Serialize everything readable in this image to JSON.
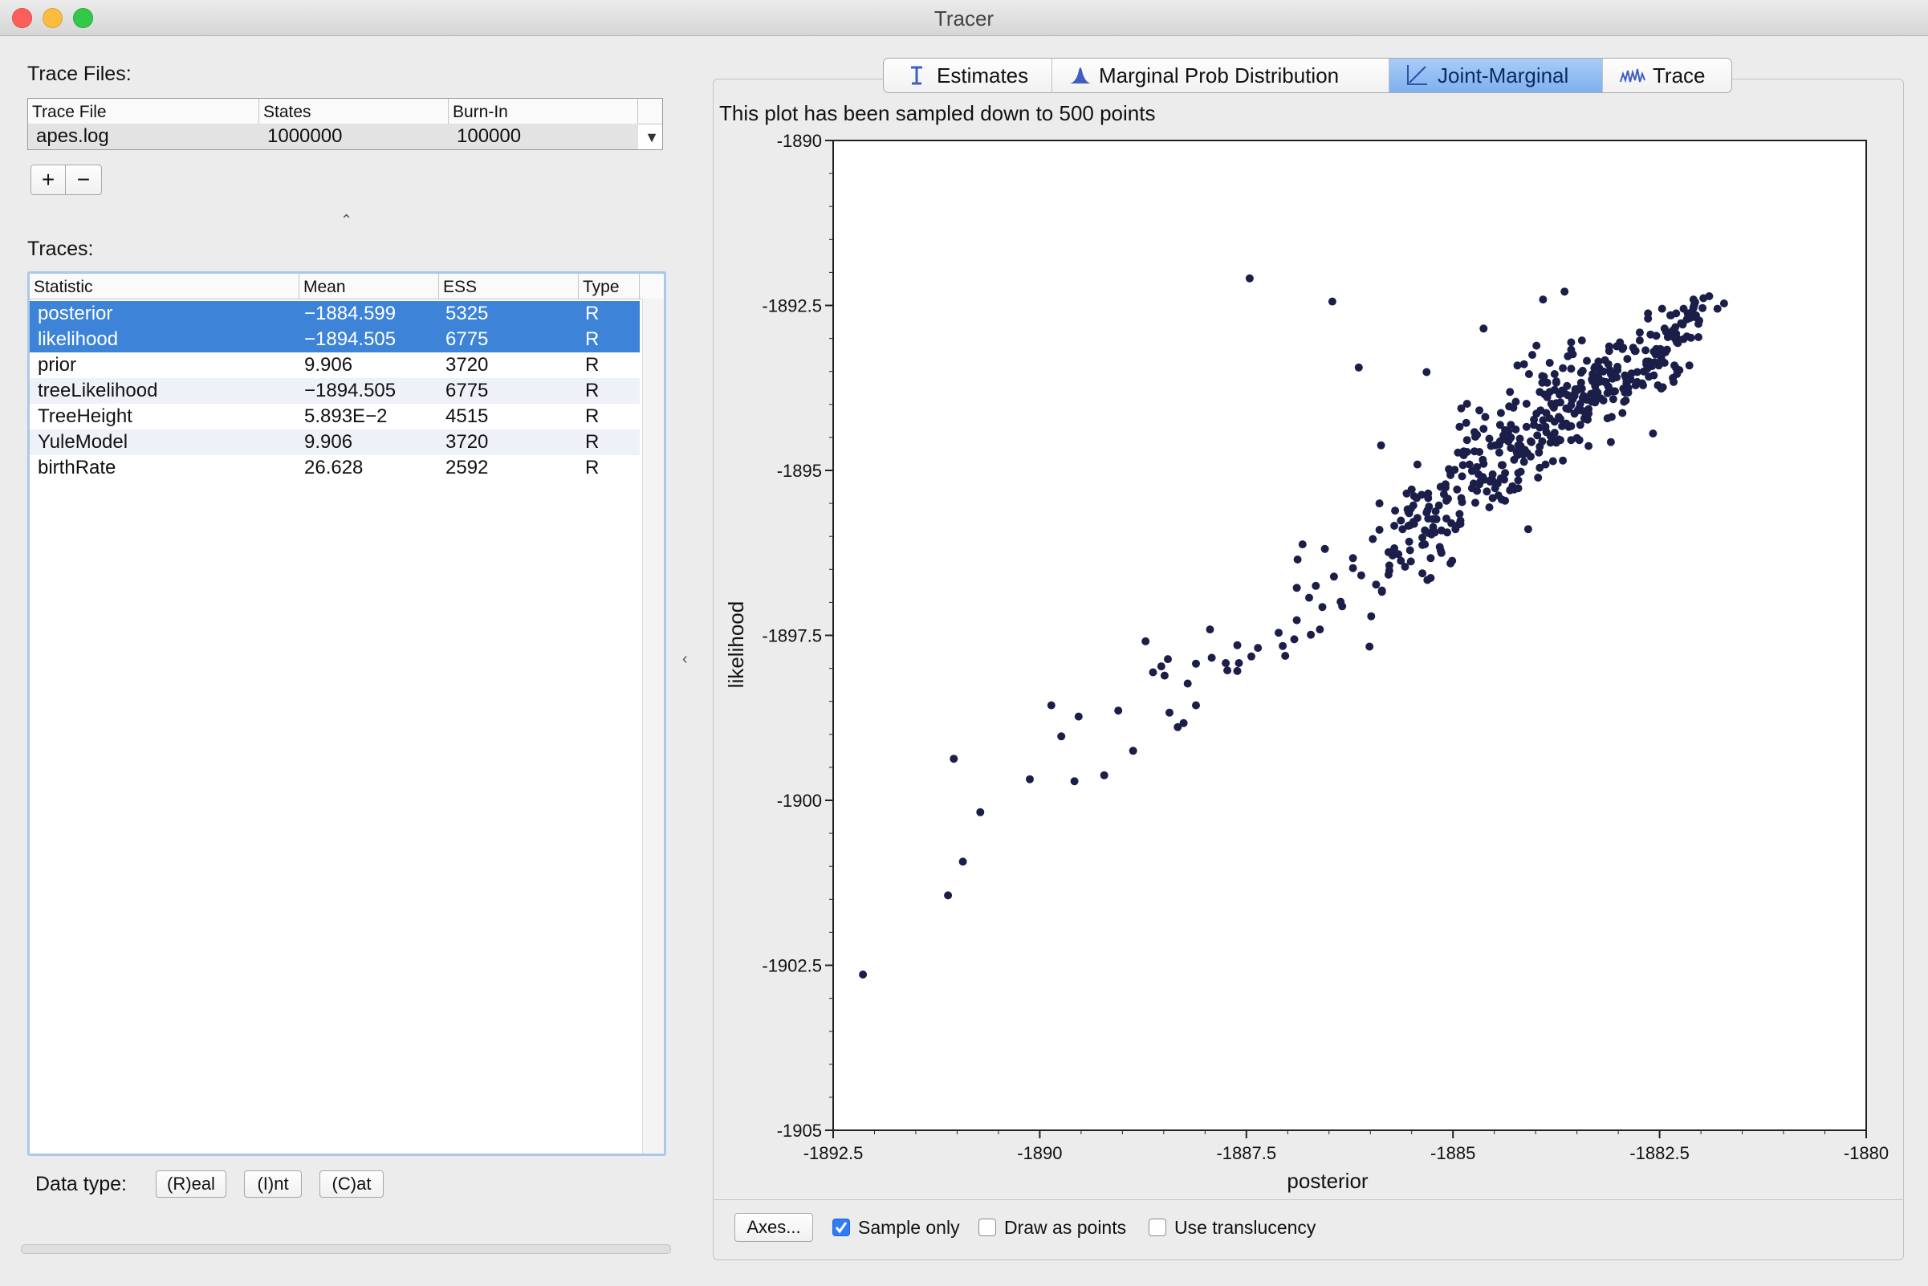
{
  "window": {
    "title": "Tracer"
  },
  "trace_files": {
    "label": "Trace Files:",
    "columns": [
      "Trace File",
      "States",
      "Burn-In"
    ],
    "rows": [
      {
        "file": "apes.log",
        "states": "1000000",
        "burnin": "100000"
      }
    ],
    "add_label": "+",
    "remove_label": "−"
  },
  "traces": {
    "label": "Traces:",
    "columns": [
      "Statistic",
      "Mean",
      "ESS",
      "Type"
    ],
    "rows": [
      {
        "statistic": "posterior",
        "mean": "−1884.599",
        "ess": "5325",
        "type": "R",
        "selected": true
      },
      {
        "statistic": "likelihood",
        "mean": "−1894.505",
        "ess": "6775",
        "type": "R",
        "selected": true
      },
      {
        "statistic": "prior",
        "mean": "9.906",
        "ess": "3720",
        "type": "R",
        "selected": false
      },
      {
        "statistic": "treeLikelihood",
        "mean": "−1894.505",
        "ess": "6775",
        "type": "R",
        "selected": false
      },
      {
        "statistic": "TreeHeight",
        "mean": "5.893E−2",
        "ess": "4515",
        "type": "R",
        "selected": false
      },
      {
        "statistic": "YuleModel",
        "mean": "9.906",
        "ess": "3720",
        "type": "R",
        "selected": false
      },
      {
        "statistic": "birthRate",
        "mean": "26.628",
        "ess": "2592",
        "type": "R",
        "selected": false
      }
    ]
  },
  "data_type": {
    "label": "Data type:",
    "real_label": "(R)eal",
    "int_label": "(I)nt",
    "cat_label": "(C)at"
  },
  "tabs": [
    {
      "label": "Estimates",
      "icon": "estimates-icon",
      "active": false
    },
    {
      "label": "Marginal Prob Distribution",
      "icon": "distribution-icon",
      "active": false
    },
    {
      "label": "Joint-Marginal",
      "icon": "joint-marginal-icon",
      "active": true
    },
    {
      "label": "Trace",
      "icon": "trace-icon",
      "active": false
    }
  ],
  "plot": {
    "note": "This plot has been sampled down to 500 points"
  },
  "bottom_bar": {
    "axes_label": "Axes...",
    "sample_only": {
      "label": "Sample only",
      "checked": true
    },
    "draw_points": {
      "label": "Draw as points",
      "checked": false
    },
    "translucency": {
      "label": "Use translucency",
      "checked": false
    }
  },
  "colors": {
    "accent": "#3d83d7",
    "points": "#1c1e4a"
  },
  "chart_data": {
    "type": "scatter",
    "xlabel": "posterior",
    "ylabel": "likelihood",
    "xlim": [
      -1892.5,
      -1880
    ],
    "ylim": [
      -1905,
      -1890
    ],
    "xticks": [
      -1892.5,
      -1890,
      -1887.5,
      -1885,
      -1882.5,
      -1880
    ],
    "xtick_labels": [
      "-1892.5",
      "-1890",
      "-1887.5",
      "-1885",
      "-1882.5",
      "-1880"
    ],
    "yticks": [
      -1890,
      -1892.5,
      -1895,
      -1897.5,
      -1900,
      -1902.5,
      -1905
    ],
    "ytick_labels": [
      "-1890",
      "-1892.5",
      "-1895",
      "-1897.5",
      "-1900",
      "-1902.5",
      "-1905"
    ],
    "grid": false,
    "x": [
      -1892.14,
      -1891.11,
      -1890.93,
      -1891.04,
      -1890.72,
      -1890.12,
      -1889.86,
      -1889.58,
      -1889.74,
      -1889.22,
      -1889.53,
      -1889.05,
      -1888.87,
      -1888.63,
      -1888.72,
      -1888.43,
      -1888.53,
      -1888.45,
      -1888.33,
      -1888.11,
      -1888.49,
      -1888.26,
      -1888.11,
      -1888.21,
      -1887.92,
      -1887.73,
      -1887.94,
      -1887.75,
      -1887.61,
      -1887.44,
      -1887.36,
      -1887.61,
      -1887.59,
      -1887.11,
      -1887.03,
      -1887.06,
      -1886.89,
      -1886.92,
      -1886.72,
      -1886.61,
      -1886.74,
      -1886.58,
      -1886.44,
      -1886.36,
      -1886.21,
      -1885.93,
      -1885.71,
      -1885.58,
      -1885.43,
      -1885.29,
      -1885.08,
      -1884.93,
      -1884.71,
      -1884.55,
      -1884.37,
      -1884.21,
      -1884.06,
      -1883.88,
      -1883.72,
      -1883.53,
      -1883.36,
      -1883.18,
      -1883.01,
      -1882.84,
      -1882.67,
      -1882.51,
      -1882.33,
      -1882.17,
      -1882.03,
      -1881.9,
      -1881.8,
      -1881.72,
      -1884.63,
      -1883.91,
      -1883.65,
      -1885.32,
      -1883.44,
      -1886.46,
      -1887.46,
      -1885.87,
      -1886.14,
      -1884.87,
      -1883.02,
      -1884.45,
      -1882.74,
      -1883.27,
      -1885.99,
      -1884.09,
      -1882.4,
      -1883.79,
      -1884.22,
      -1885.14,
      -1882.95,
      -1886.11,
      -1883.57,
      -1884.38,
      -1883.09,
      -1884.68,
      -1882.12,
      -1886.34,
      -1885.55,
      -1882.58,
      -1884.83,
      -1883.75,
      -1885.44,
      -1883.33,
      -1882.89,
      -1885.78,
      -1885.34,
      -1884.49,
      -1882.24,
      -1884.27,
      -1886.01,
      -1883.61,
      -1882.47,
      -1885.2,
      -1886.55,
      -1884.31,
      -1882.79,
      -1885.61,
      -1883.99,
      -1882.37,
      -1886.66,
      -1884.18,
      -1883.41,
      -1885.03,
      -1885.86,
      -1882.63,
      -1882.94,
      -1884.8,
      -1886.21,
      -1883.13,
      -1883.7,
      -1885.71,
      -1886.88,
      -1883.47,
      -1882.21,
      -1882.55,
      -1882.02,
      -1885.97,
      -1883.62,
      -1884.95,
      -1885.24,
      -1881.98,
      -1882.77,
      -1884.74,
      -1883.36,
      -1883.6,
      -1883.95,
      -1886.82,
      -1885.53,
      -1883.45,
      -1882.3,
      -1883.7,
      -1882.79,
      -1882.44,
      -1881.97,
      -1882.91,
      -1882.49,
      -1884.24,
      -1884.04,
      -1885.15,
      -1882.65,
      -1883.78,
      -1883.95,
      -1884.14,
      -1885.02,
      -1882.69,
      -1884.71,
      -1884.3,
      -1884.98,
      -1884.77,
      -1883.29,
      -1886.89,
      -1884.14,
      -1883.44,
      -1884.3,
      -1884.63,
      -1884.21,
      -1882.61,
      -1883.12,
      -1884.91,
      -1883.43,
      -1882.66,
      -1884.02,
      -1883.83,
      -1883.46,
      -1883.75,
      -1883.71,
      -1883.12,
      -1883.23,
      -1884.43,
      -1882.29,
      -1884.37,
      -1882.28,
      -1884.22,
      -1885.11,
      -1884.68,
      -1885.47,
      -1885.89,
      -1884.49,
      -1883.09,
      -1882.51,
      -1883.89,
      -1884.24,
      -1882.94,
      -1883.56,
      -1883.27,
      -1885.7,
      -1884.94,
      -1883.15,
      -1882.6,
      -1885.29,
      -1884.31,
      -1883.87,
      -1885.07,
      -1885.27,
      -1884.42,
      -1883.25,
      -1882.95,
      -1884.21,
      -1885.17,
      -1882.56,
      -1883.5,
      -1885.03,
      -1882.43,
      -1885.48,
      -1882.54,
      -1882.31,
      -1882.63,
      -1884.26,
      -1883.49,
      -1883.63,
      -1883.57,
      -1882.36,
      -1882.12,
      -1883.23,
      -1883.22,
      -1882.17,
      -1882.13,
      -1884.52,
      -1883.48,
      -1884.87,
      -1883.77,
      -1885.06,
      -1883.92,
      -1882.52,
      -1884.77,
      -1884.33,
      -1883.02,
      -1883.88,
      -1884.39,
      -1883.16,
      -1883.4,
      -1885.38,
      -1883.75,
      -1882.28,
      -1882.3,
      -1883.68,
      -1885.24,
      -1882.21,
      -1883.65,
      -1884.05,
      -1883.95,
      -1882.92,
      -1885.66,
      -1884.18,
      -1884.71,
      -1884.67,
      -1885.47,
      -1882.71,
      -1884.53,
      -1882.57,
      -1883.12,
      -1884.02,
      -1883.07,
      -1884.97,
      -1883.24,
      -1884.43,
      -1884.73,
      -1885.14,
      -1882.66,
      -1883.01,
      -1883.53,
      -1884.91,
      -1885.53,
      -1883.1,
      -1882.07,
      -1883.86,
      -1884.83,
      -1885.15,
      -1884.33,
      -1883.38,
      -1884.51,
      -1885.86,
      -1882.09,
      -1884.11,
      -1883.27,
      -1883.57,
      -1884.19,
      -1884.46,
      -1884.89,
      -1883.75,
      -1882.12,
      -1882.9,
      -1885.5,
      -1883.08,
      -1883.9,
      -1885.37,
      -1884.29,
      -1882.03,
      -1882.82,
      -1885.34,
      -1884.3,
      -1882.88,
      -1884.44,
      -1883.95,
      -1885.51,
      -1882.16,
      -1883.32,
      -1882.91,
      -1885.27,
      -1882.3,
      -1882.54,
      -1884.42,
      -1884.63,
      -1883.67,
      -1883.21,
      -1882.59,
      -1883.28,
      -1882.32,
      -1883.31,
      -1882.48,
      -1883.81,
      -1884.22,
      -1883.53,
      -1884.69,
      -1882.64,
      -1884.32,
      -1883.77,
      -1883.29,
      -1882.09,
      -1883.43,
      -1882.44,
      -1885.3,
      -1884.41,
      -1882.55,
      -1884.61,
      -1885.05,
      -1884.37,
      -1883.11,
      -1883.42,
      -1882.08,
      -1882.98,
      -1883.77,
      -1882.26,
      -1884.26,
      -1883.97,
      -1882.8,
      -1882.14,
      -1883.92,
      -1885.31,
      -1884.08,
      -1883.79,
      -1883.82,
      -1883.94,
      -1885.08,
      -1882.34,
      -1885.3,
      -1882.7,
      -1885.32,
      -1885.01,
      -1885.26,
      -1884.06,
      -1884.1,
      -1884.75,
      -1883.57,
      -1882.9,
      -1882.33,
      -1882.3,
      -1885.78,
      -1883.91,
      -1882.33,
      -1884.59,
      -1885.56,
      -1883.8,
      -1885.63,
      -1883.18,
      -1882.06,
      -1884.92,
      -1883.98,
      -1882.46,
      -1884.54,
      -1883.07,
      -1882.77,
      -1884.83,
      -1884.31,
      -1885.24,
      -1885.37,
      -1883.06,
      -1883.7,
      -1884.44,
      -1883.57,
      -1882.33,
      -1883.96,
      -1885.51,
      -1884.15,
      -1884.64,
      -1883.31,
      -1884.73,
      -1883.49,
      -1885.03,
      -1885.77,
      -1885.21,
      -1883.32,
      -1883.11,
      -1883.04,
      -1883.67,
      -1883.28,
      -1884.62,
      -1882.9,
      -1882.85,
      -1883.99,
      -1883.57,
      -1884.21,
      -1885.48,
      -1883.68,
      -1885.31,
      -1883.47,
      -1885.16,
      -1883.6,
      -1883.83,
      -1883.43,
      -1882.29,
      -1884.56,
      -1885.73,
      -1885.22,
      -1884.28,
      -1882.09,
      -1884.39,
      -1882.64,
      -1883.61,
      -1883.13,
      -1885.89,
      -1884.23,
      -1883.55,
      -1885.77,
      -1883.77,
      -1884.41,
      -1884.89,
      -1882.92,
      -1884.84,
      -1882.88,
      -1884.9,
      -1882.34,
      -1882.64,
      -1883.45,
      -1882.93,
      -1882.22,
      -1883.25,
      -1883.24,
      -1882.57,
      -1883.86,
      -1883.82,
      -1882.12,
      -1882.14,
      -1883.52,
      -1884.4,
      -1882.47,
      -1882.41,
      -1884.11,
      -1882.06,
      -1885.63,
      -1884.52,
      -1883.46,
      -1885.09,
      -1885.09,
      -1885.37,
      -1883.15,
      -1883.83,
      -1884.92,
      -1883.92,
      -1885.3,
      -1885.52,
      -1883.28,
      -1883.37,
      -1883.55,
      -1883.87,
      -1883.29,
      -1884.74,
      -1883.63,
      -1883.19,
      -1884.13,
      -1883.72,
      -1882.42,
      -1883.28,
      -1883.36,
      -1882.74,
      -1884.64,
      -1885.43,
      -1884.9,
      -1882.48,
      -1884.68,
      -1884.56,
      -1883.07,
      -1883.38,
      -1884.88,
      -1885.54,
      -1885.52,
      -1885.54
    ],
    "y": [
      -1902.64,
      -1901.44,
      -1900.93,
      -1899.37,
      -1900.18,
      -1899.68,
      -1898.56,
      -1899.71,
      -1899.03,
      -1899.62,
      -1898.73,
      -1898.64,
      -1899.25,
      -1898.06,
      -1897.59,
      -1898.67,
      -1897.97,
      -1897.86,
      -1898.89,
      -1898.56,
      -1898.11,
      -1898.83,
      -1897.93,
      -1898.23,
      -1897.84,
      -1898.03,
      -1897.41,
      -1897.92,
      -1898.04,
      -1897.82,
      -1897.69,
      -1897.65,
      -1897.92,
      -1897.46,
      -1897.81,
      -1897.66,
      -1897.27,
      -1897.56,
      -1897.49,
      -1897.41,
      -1896.93,
      -1897.07,
      -1896.61,
      -1896.99,
      -1896.33,
      -1896.73,
      -1896.18,
      -1896.46,
      -1895.72,
      -1895.95,
      -1895.46,
      -1895.82,
      -1895.31,
      -1895.17,
      -1895.04,
      -1895.15,
      -1894.79,
      -1894.34,
      -1894.53,
      -1894.14,
      -1894.07,
      -1893.94,
      -1893.48,
      -1893.53,
      -1893.18,
      -1893.41,
      -1892.98,
      -1892.71,
      -1892.78,
      -1892.36,
      -1892.55,
      -1892.47,
      -1892.85,
      -1892.41,
      -1892.29,
      -1893.51,
      -1893.03,
      -1892.44,
      -1892.09,
      -1894.62,
      -1893.44,
      -1894.77,
      -1893.12,
      -1895.38,
      -1892.91,
      -1893.59,
      -1897.21,
      -1895.89,
      -1892.98,
      -1894.86,
      -1893.41,
      -1895.91,
      -1894.13,
      -1896.59,
      -1893.06,
      -1895.14,
      -1894.57,
      -1894.09,
      -1892.61,
      -1897.06,
      -1895.59,
      -1894.44,
      -1893.99,
      -1893.65,
      -1895.42,
      -1893.84,
      -1893.31,
      -1896.24,
      -1896.12,
      -1894.62,
      -1892.77,
      -1894.05,
      -1897.67,
      -1893.27,
      -1892.55,
      -1895.74,
      -1896.19,
      -1894.52,
      -1893.71,
      -1895.89,
      -1893.11,
      -1892.65,
      -1896.75,
      -1895.02,
      -1894.21,
      -1896.41,
      -1896.82,
      -1893.35,
      -1893.76,
      -1894.91,
      -1896.48,
      -1894.21,
      -1893.97,
      -1895.84,
      -1896.35,
      -1894.05,
      -1893.01,
      -1893.38,
      -1892.73,
      -1896.04,
      -1893.72,
      -1895.29,
      -1895.93,
      -1892.54,
      -1893.51,
      -1894.42,
      -1894.14,
      -1894.34,
      -1893.81,
      -1896.12,
      -1895.65,
      -1893.52,
      -1893.03,
      -1894.54,
      -1893.19,
      -1892.85,
      -1892.39,
      -1893.94,
      -1893.16,
      -1893.96,
      -1893.25,
      -1896.21,
      -1893.46,
      -1894.05,
      -1894.96,
      -1894.87,
      -1895.8,
      -1893.5,
      -1894.95,
      -1894.31,
      -1894.99,
      -1895.27,
      -1893.45,
      -1896.78,
      -1893.39,
      -1893.76,
      -1894.66,
      -1894.37,
      -1895.27,
      -1892.94,
      -1893.73,
      -1895.76,
      -1894.1,
      -1893.35,
      -1894.23,
      -1893.81,
      -1893.99,
      -1894.58,
      -1893.85,
      -1893.73,
      -1893.45,
      -1894.31,
      -1893.06,
      -1894.39,
      -1893.01,
      -1894.77,
      -1895.36,
      -1894.72,
      -1895.81,
      -1895.5,
      -1895.27,
      -1893.54,
      -1893.19,
      -1893.85,
      -1894.38,
      -1893.14,
      -1893.93,
      -1893.79,
      -1895.61,
      -1894.73,
      -1893.66,
      -1893.37,
      -1895.55,
      -1895.3,
      -1894.13,
      -1895.94,
      -1896.63,
      -1895.12,
      -1893.82,
      -1893.16,
      -1894.62,
      -1895.53,
      -1893.36,
      -1894.51,
      -1895.03,
      -1893.21,
      -1895.53,
      -1893.16,
      -1892.83,
      -1893.58,
      -1895.29,
      -1893.78,
      -1894.06,
      -1894.33,
      -1892.65,
      -1892.68,
      -1893.66,
      -1893.5,
      -1892.97,
      -1892.69,
      -1895.06,
      -1893.76,
      -1894.71,
      -1893.54,
      -1895.43,
      -1893.57,
      -1893.71,
      -1895.01,
      -1894.41,
      -1893.59,
      -1894.91,
      -1894.53,
      -1893.33,
      -1894.22,
      -1895.37,
      -1893.67,
      -1893.07,
      -1893.45,
      -1894.33,
      -1895.86,
      -1892.55,
      -1893.83,
      -1894.57,
      -1894.35,
      -1893.56,
      -1896.27,
      -1894.63,
      -1894.46,
      -1895.17,
      -1895.39,
      -1893.68,
      -1895.13,
      -1893.2,
      -1893.39,
      -1894.31,
      -1893.61,
      -1895.89,
      -1893.35,
      -1894.56,
      -1895.49,
      -1896.25,
      -1893.39,
      -1893.43,
      -1893.87,
      -1895.81,
      -1896.08,
      -1893.48,
      -1892.45,
      -1893.89,
      -1894.54,
      -1895.25,
      -1894.56,
      -1893.93,
      -1895.17,
      -1896.84,
      -1892.54,
      -1893.99,
      -1893.85,
      -1893.46,
      -1894.52,
      -1895.2,
      -1895.48,
      -1893.98,
      -1892.99,
      -1893.68,
      -1895.29,
      -1894.19,
      -1893.58,
      -1896.56,
      -1895.28,
      -1892.98,
      -1893.14,
      -1895.91,
      -1894.5,
      -1893.82,
      -1894.61,
      -1894.64,
      -1896.38,
      -1892.62,
      -1893.62,
      -1893.59,
      -1896.33,
      -1892.93,
      -1892.96,
      -1894.13,
      -1894.9,
      -1894.85,
      -1893.91,
      -1893.42,
      -1893.58,
      -1893.41,
      -1893.65,
      -1893.3,
      -1893.99,
      -1894.72,
      -1893.84,
      -1895.06,
      -1893.44,
      -1894.03,
      -1894.26,
      -1893.61,
      -1892.41,
      -1893.9,
      -1893.37,
      -1895.73,
      -1894.92,
      -1893.24,
      -1894.19,
      -1894.98,
      -1895.46,
      -1893.19,
      -1893.87,
      -1892.49,
      -1893.06,
      -1894.43,
      -1893.48,
      -1894.84,
      -1895.11,
      -1893.19,
      -1893.41,
      -1893.67,
      -1896.66,
      -1893.54,
      -1894.03,
      -1894.48,
      -1894.09,
      -1895.73,
      -1893.6,
      -1895.35,
      -1893.71,
      -1895.64,
      -1896.37,
      -1895.97,
      -1894.56,
      -1894.74,
      -1895.2,
      -1893.17,
      -1893.75,
      -1892.97,
      -1892.62,
      -1896.58,
      -1894.24,
      -1892.91,
      -1895.32,
      -1895.35,
      -1894.52,
      -1896.37,
      -1893.5,
      -1892.68,
      -1894.34,
      -1894.47,
      -1893.74,
      -1894.63,
      -1893.56,
      -1893.66,
      -1894.72,
      -1893.81,
      -1895.74,
      -1896.02,
      -1893.92,
      -1894.22,
      -1894.73,
      -1894.01,
      -1893.66,
      -1894.73,
      -1895.58,
      -1894.76,
      -1895.1,
      -1893.54,
      -1894.49,
      -1894.09,
      -1895.07,
      -1896.44,
      -1895.62,
      -1893.96,
      -1893.12,
      -1893.8,
      -1893.45,
      -1893.72,
      -1895.14,
      -1893.66,
      -1893.62,
      -1894.14,
      -1894.54,
      -1895.04,
      -1895.78,
      -1893.79,
      -1895.61,
      -1894.54,
      -1896.16,
      -1894.07,
      -1893.37,
      -1893.49,
      -1893.54,
      -1895.56,
      -1896.29,
      -1895.94,
      -1895.24,
      -1892.53,
      -1894.47,
      -1892.7,
      -1893.86,
      -1893.83,
      -1895.9,
      -1894.72,
      -1893.24,
      -1896.52,
      -1893.78,
      -1895.44,
      -1895.09,
      -1893.82,
      -1894.28,
      -1893.75,
      -1894.06,
      -1892.88,
      -1892.62,
      -1893.67,
      -1893.96,
      -1892.79,
      -1893.64,
      -1893.59,
      -1893.56,
      -1893.67,
      -1894.58,
      -1892.65,
      -1892.68,
      -1893.77,
      -1894.92,
      -1893.18,
      -1893.17,
      -1894.34,
      -1892.65,
      -1895.76,
      -1895.42,
      -1894.31,
      -1895.26,
      -1895.21,
      -1896.13,
      -1893.67,
      -1894.21,
      -1895.66,
      -1894.56,
      -1895.42,
      -1895.83,
      -1893.43,
      -1894.23,
      -1893.92,
      -1894.42,
      -1893.92,
      -1894.71,
      -1894.29,
      -1893.65,
      -1894.69,
      -1894.19,
      -1892.9,
      -1893.97,
      -1894.63,
      -1893.03,
      -1894.84,
      -1894.91,
      -1895.42,
      -1893.76,
      -1895.21,
      -1894.52,
      -1893.8,
      -1893.34,
      -1894.92,
      -1895.84,
      -1896.21,
      -1895.63
    ]
  }
}
